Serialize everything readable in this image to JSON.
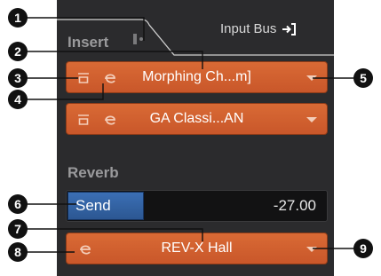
{
  "insert": {
    "label": "Insert",
    "input_bus_label": "Input Bus",
    "slots": [
      {
        "name": "Morphing Ch...m]",
        "has_bypass": true
      },
      {
        "name": "GA Classi...AN",
        "has_bypass": true
      }
    ]
  },
  "reverb": {
    "label": "Reverb",
    "send_label": "Send",
    "send_value": "-27.00",
    "effect_name": "REV-X Hall"
  },
  "callouts": [
    "1",
    "2",
    "3",
    "4",
    "5",
    "6",
    "7",
    "8",
    "9"
  ],
  "colors": {
    "panel": "#2b2b2d",
    "slot_orange": "#d96a35",
    "send_blue": "#3b6fb5",
    "callout": "#111111"
  }
}
